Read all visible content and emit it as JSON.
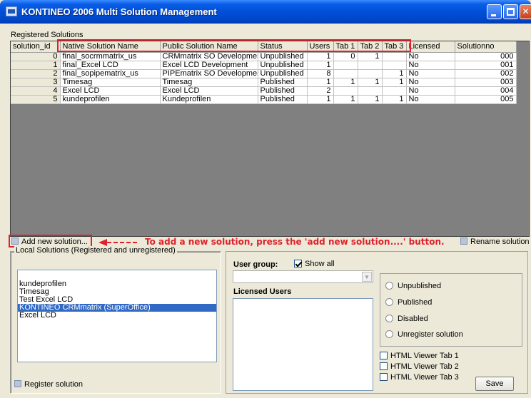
{
  "window": {
    "title": "KONTINEO 2006 Multi Solution Management"
  },
  "registered": {
    "label": "Registered Solutions",
    "columns": [
      "solution_id",
      "Native Solution Name",
      "Public Solution Name",
      "Status",
      "Users",
      "Tab 1",
      "Tab 2",
      "Tab 3",
      "Licensed",
      "Solutionno"
    ],
    "rows": [
      [
        "0",
        "final_socrmmatrix_us",
        "CRMmatrix SO Development",
        "Unpublished",
        "1",
        "0",
        "1",
        "",
        "No",
        "000"
      ],
      [
        "1",
        "final_Excel LCD",
        "Excel LCD Development",
        "Unpublished",
        "1",
        "",
        "",
        "",
        "No",
        "001"
      ],
      [
        "2",
        "final_sopipematrix_us",
        "PIPEmatrix SO Development",
        "Unpublished",
        "8",
        "",
        "",
        "1",
        "No",
        "002"
      ],
      [
        "3",
        "Timesag",
        "Timesag",
        "Published",
        "1",
        "1",
        "1",
        "1",
        "No",
        "003"
      ],
      [
        "4",
        "Excel LCD",
        "Excel LCD",
        "Published",
        "2",
        "",
        "",
        "",
        "No",
        "004"
      ],
      [
        "5",
        "kundeprofilen",
        "Kundeprofilen",
        "Published",
        "1",
        "1",
        "1",
        "1",
        "No",
        "005"
      ]
    ]
  },
  "toolbar": {
    "add_new": "Add new solution...",
    "rename": "Rename solution"
  },
  "annotation": "To add a new solution, press the 'add new solution....' button.",
  "local": {
    "label": "Local Solutions (Registered and unregistered)",
    "items": [
      "kundeprofilen",
      "Timesag",
      "Test Excel LCD",
      "KONTINEO CRMmatrix (SuperOffice)",
      "Excel LCD"
    ],
    "register": "Register solution"
  },
  "right": {
    "user_group_label": "User group:",
    "show_all": "Show all",
    "licensed_users": "Licensed Users",
    "status_options": [
      "Unpublished",
      "Published",
      "Disabled",
      "Unregister solution"
    ],
    "viewer_tabs": [
      "HTML Viewer Tab 1",
      "HTML Viewer Tab 2",
      "HTML Viewer Tab 3"
    ],
    "save": "Save"
  }
}
